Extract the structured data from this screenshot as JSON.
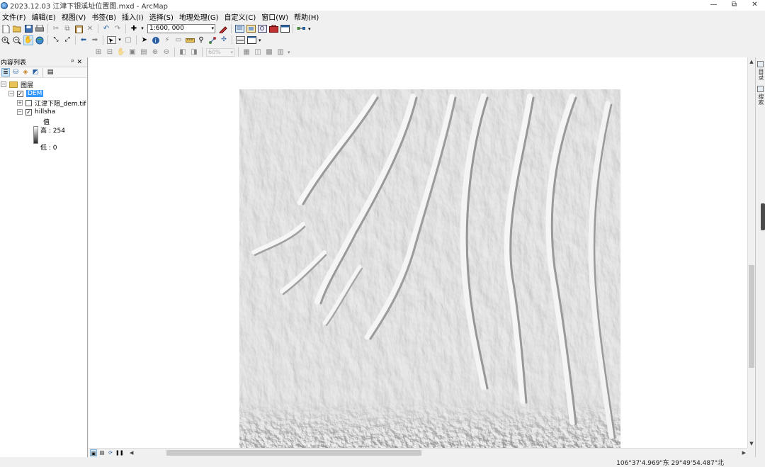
{
  "window": {
    "title": "2023.12.03 江津下银溪址位置图.mxd - ArcMap",
    "minimize": "—",
    "restore": "⧉",
    "close": "✕"
  },
  "menu": [
    "文件(F)",
    "编辑(E)",
    "视图(V)",
    "书签(B)",
    "插入(I)",
    "选择(S)",
    "地理处理(G)",
    "自定义(C)",
    "窗口(W)",
    "帮助(H)"
  ],
  "toolbar": {
    "scale_value": "1:600, 000",
    "zoom_value": "60%"
  },
  "toc": {
    "title": "内容列表",
    "pin": "ᵖ",
    "close": "✕",
    "root_label": "图层",
    "layers": [
      {
        "label": "DEM",
        "checked": true,
        "selected": true,
        "expanded": true
      },
      {
        "label": "江津下阻_dem.tif",
        "checked": false,
        "selected": false,
        "expanded": false
      },
      {
        "label": "hillsha",
        "checked": true,
        "selected": false,
        "expanded": true
      }
    ],
    "legend": {
      "field": "值",
      "high": "高 : 254",
      "low": "低 : 0"
    }
  },
  "map": {
    "layer": "hillshade relief of DEM"
  },
  "statusbar": {
    "coordinates": "106°37'4.969\"东  29°49'54.487\"北"
  },
  "right_dock": {
    "tab1": "目录",
    "tab2": "搜索"
  }
}
